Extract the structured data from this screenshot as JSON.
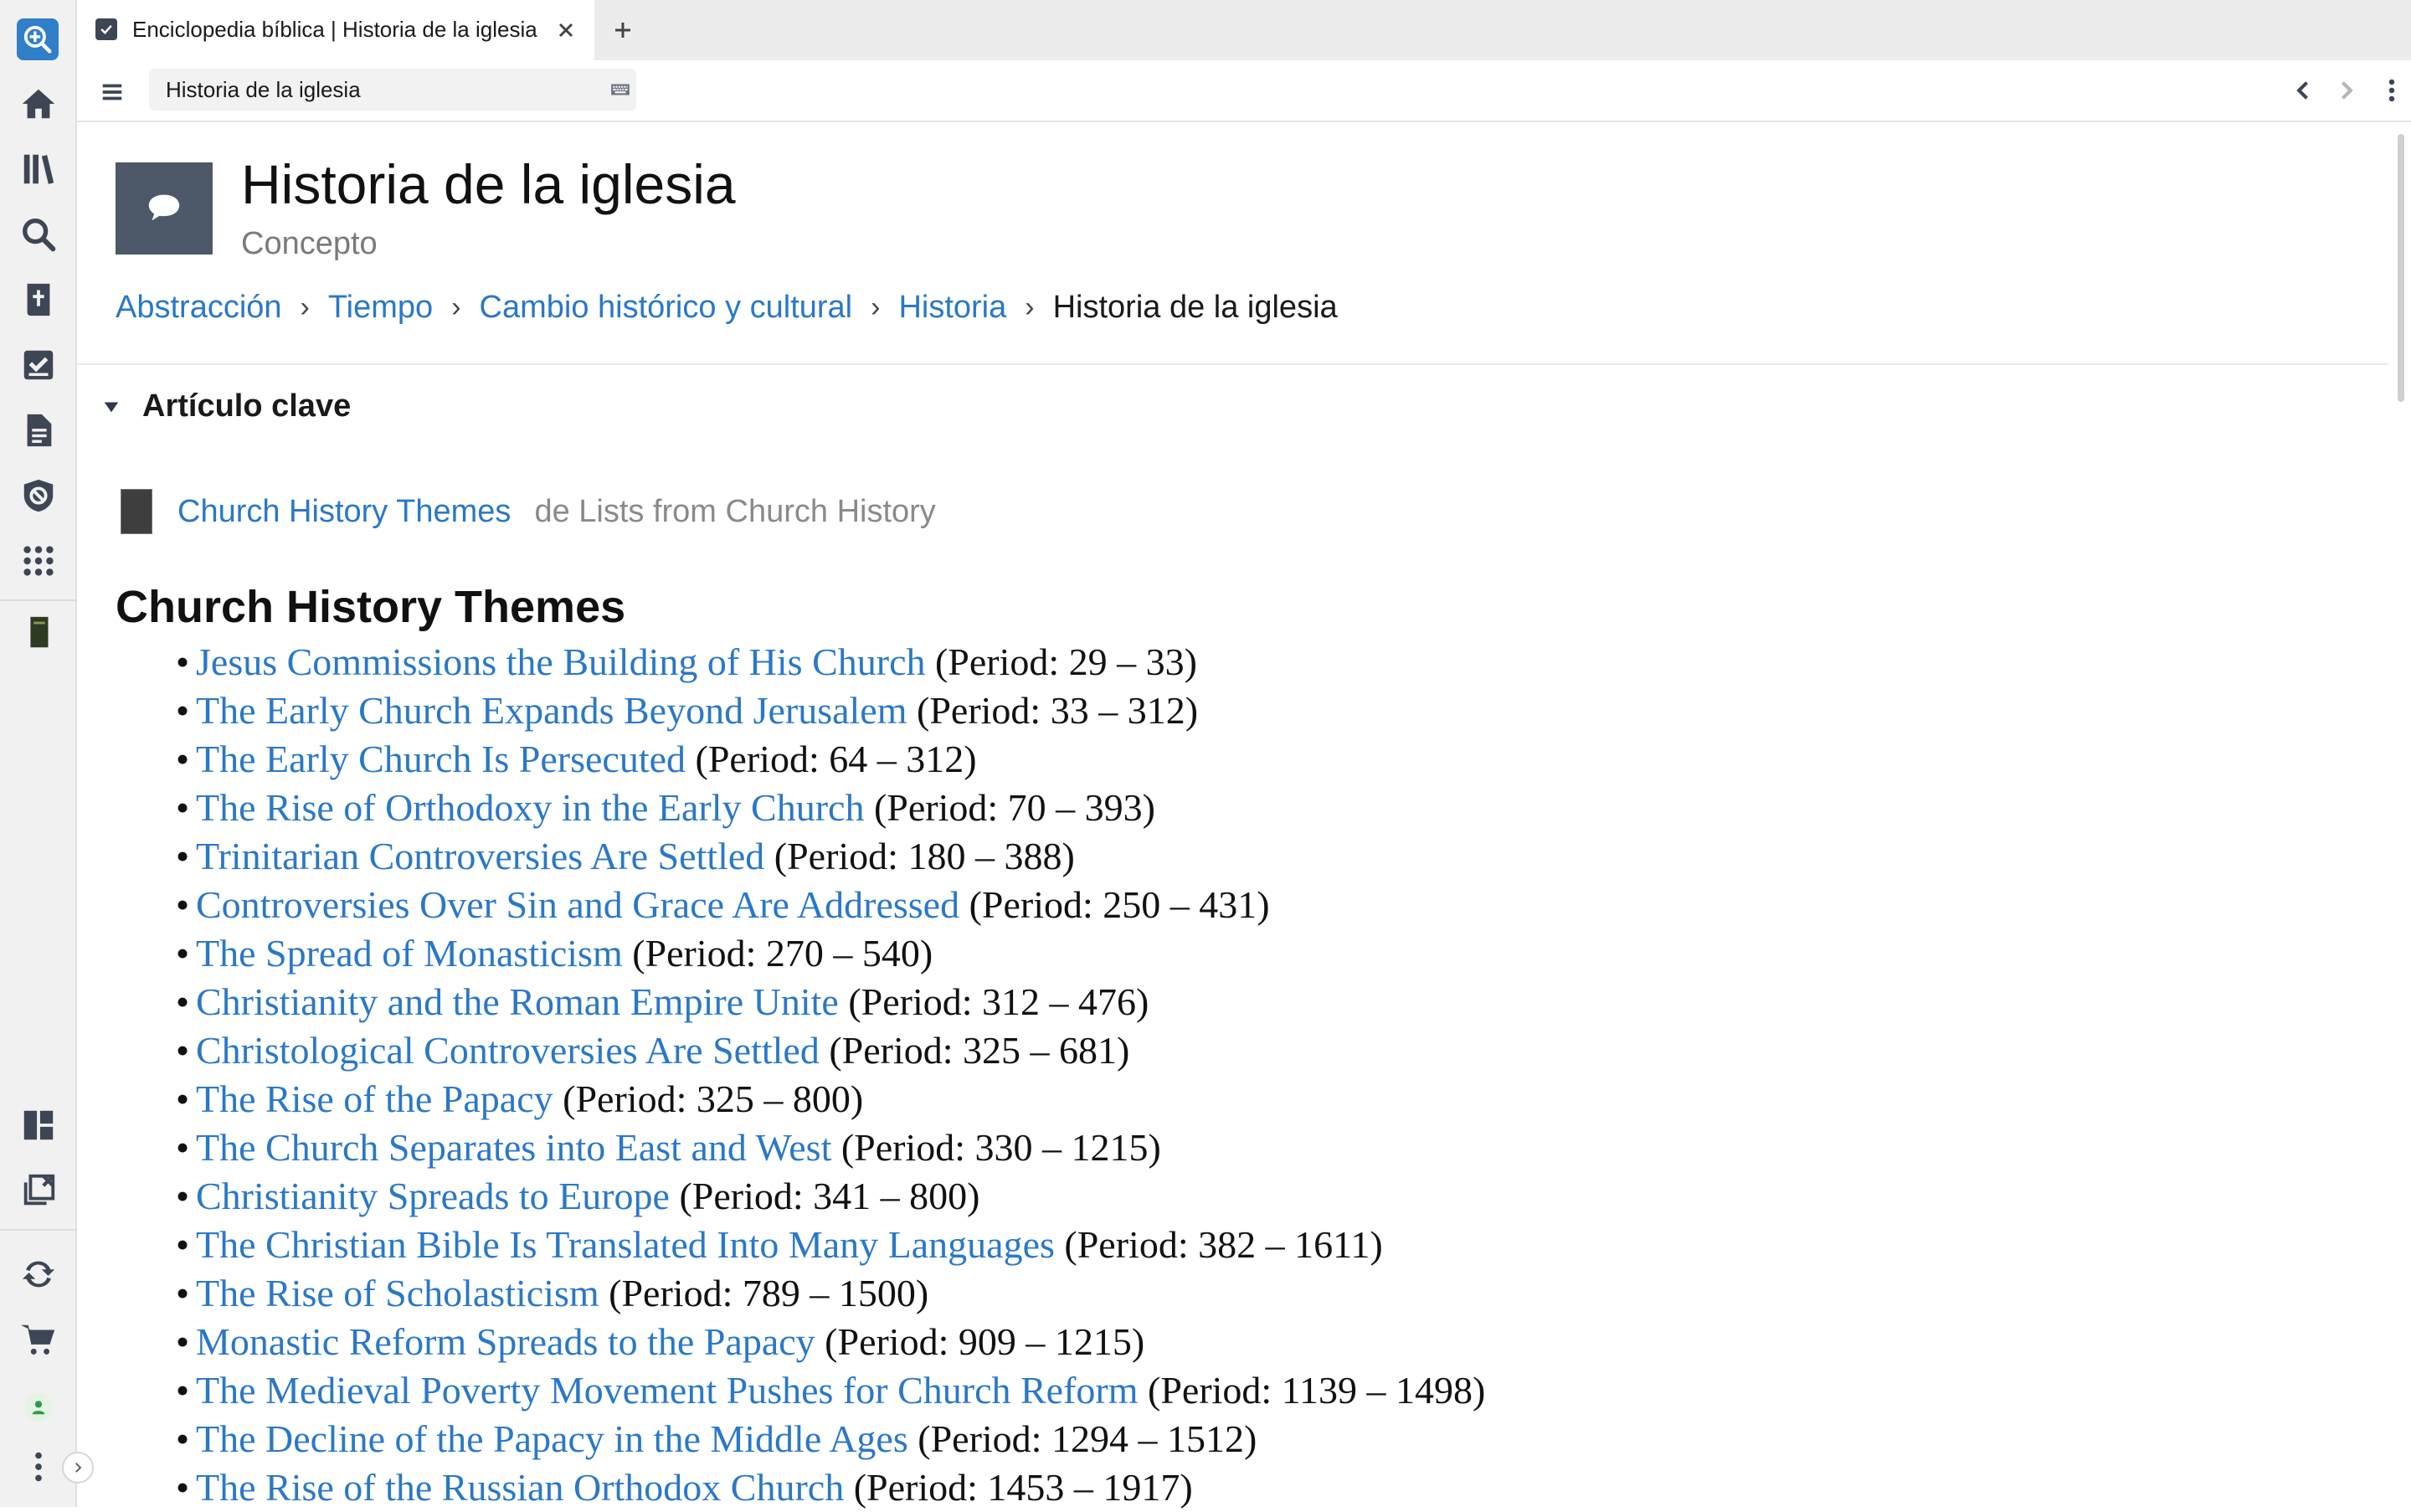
{
  "tab": {
    "title": "Enciclopedia bíblica | Historia de la iglesia"
  },
  "toolbar": {
    "address_value": "Historia de la iglesia"
  },
  "sidebar": {
    "items": [
      {
        "icon": "home-icon"
      },
      {
        "icon": "library-icon"
      },
      {
        "icon": "search-icon"
      },
      {
        "icon": "bible-icon"
      },
      {
        "icon": "reading-plan-icon"
      },
      {
        "icon": "document-icon"
      },
      {
        "icon": "verbum-icon"
      },
      {
        "icon": "apps-grid-icon"
      },
      {
        "icon": "open-book-icon"
      },
      {
        "icon": "layouts-icon"
      },
      {
        "icon": "close-panels-icon"
      },
      {
        "icon": "sync-icon"
      },
      {
        "icon": "cart-icon"
      },
      {
        "icon": "user-avatar-icon"
      },
      {
        "icon": "more-icon"
      }
    ]
  },
  "header": {
    "title": "Historia de la iglesia",
    "subtitle": "Concepto"
  },
  "breadcrumb": {
    "items": [
      "Abstracción",
      "Tiempo",
      "Cambio histórico y cultural",
      "Historia"
    ],
    "current": "Historia de la iglesia",
    "separator": "›"
  },
  "section": {
    "title": "Artículo clave",
    "article_link": "Church History Themes",
    "article_source": "de Lists from Church History"
  },
  "article": {
    "heading": "Church History Themes",
    "bullet": "•",
    "themes": [
      {
        "title": "Jesus Commissions the Building of His Church",
        "period": "(Period: 29 – 33)"
      },
      {
        "title": "The Early Church Expands Beyond Jerusalem",
        "period": "(Period: 33 – 312)"
      },
      {
        "title": "The Early Church Is Persecuted",
        "period": "(Period: 64 – 312)"
      },
      {
        "title": "The Rise of Orthodoxy in the Early Church",
        "period": "(Period: 70 – 393)"
      },
      {
        "title": "Trinitarian Controversies Are Settled",
        "period": "(Period: 180 – 388)"
      },
      {
        "title": "Controversies Over Sin and Grace Are Addressed",
        "period": "(Period: 250 – 431)"
      },
      {
        "title": "The Spread of Monasticism",
        "period": "(Period: 270 – 540)"
      },
      {
        "title": "Christianity and the Roman Empire Unite",
        "period": "(Period: 312 – 476)"
      },
      {
        "title": "Christological Controversies Are Settled",
        "period": "(Period: 325 – 681)"
      },
      {
        "title": "The Rise of the Papacy",
        "period": "(Period: 325 – 800)"
      },
      {
        "title": "The Church Separates into East and West",
        "period": "(Period: 330 – 1215)"
      },
      {
        "title": "Christianity Spreads to Europe",
        "period": "(Period: 341 – 800)"
      },
      {
        "title": "The Christian Bible Is Translated Into Many Languages",
        "period": "(Period: 382 – 1611)"
      },
      {
        "title": "The Rise of Scholasticism",
        "period": "(Period: 789 – 1500)"
      },
      {
        "title": "Monastic Reform Spreads to the Papacy",
        "period": "(Period: 909 – 1215)"
      },
      {
        "title": "The Medieval Poverty Movement Pushes for Church Reform",
        "period": "(Period: 1139 – 1498)"
      },
      {
        "title": "The Decline of the Papacy in the Middle Ages",
        "period": "(Period: 1294 – 1512)"
      },
      {
        "title": "The Rise of the Russian Orthodox Church",
        "period": "(Period: 1453 – 1917)"
      }
    ]
  },
  "colors": {
    "link": "#2a78c8",
    "sidebar_icon": "#3d4654",
    "concept_icon_bg": "#4d5869",
    "logo_bg": "#2f7fc9",
    "avatar": "#2e9a44"
  }
}
